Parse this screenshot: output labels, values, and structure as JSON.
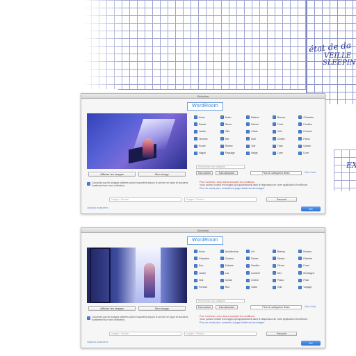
{
  "background": {
    "handwriting": [
      "état de da",
      "VEILLE",
      "SLEEPIN",
      "EX"
    ]
  },
  "dialogs": [
    {
      "title": "Sélection",
      "brand": "WordRoom",
      "photo_buttons": [
        "Afficher les images",
        "Mon image"
      ],
      "categories": [
        "Avion",
        "Avion",
        "Bateau",
        "Bureau",
        "Chambre",
        "Danse",
        "Décor",
        "Désert",
        "Foret",
        "Fenêtre",
        "Jardin",
        "Ville",
        "Chats",
        "Vélo",
        "Femme",
        "Homme",
        "Mer",
        "Nuit",
        "Ombre",
        "Piano",
        "Route",
        "Rivière",
        "Soir",
        "Train",
        "Urbain",
        "Vague",
        "Paysage",
        "Neige",
        "Lune",
        "Livre"
      ],
      "search_placeholder": "Rechercher une catégorie",
      "buttons": {
        "select_all": "Tout cocher",
        "deselect_all": "Tout décocher",
        "wide": "Plus de catégories libres",
        "help": "Aide / Aide"
      },
      "agree_text": "J'accepte que les images utilisées soient importées depuis le service en ligne et stockées localement sur mon ordinateur.",
      "red_note": "Pour continuer, vous devez accepter les conditions.",
      "grey_note": "Vous pouvez choisir les images qui apparaissent dans le diaporama de votre application WordRoom.",
      "blue_note": "Pour en savoir plus, consultez la page d'aide sur les images.",
      "input_1_placeholder": "Images / Dossier",
      "input_2_placeholder": "Images / Fichiers",
      "input_button": "Parcourir",
      "footer_link": "Options avancées",
      "ok": "OK"
    },
    {
      "title": "Sélection",
      "brand": "WordRoom",
      "photo_buttons": [
        "Afficher les images",
        "Mon image"
      ],
      "categories": [
        "Avion",
        "Architecture",
        "Art",
        "Bateau",
        "Bureau",
        "Chambre",
        "Couleur",
        "Danse",
        "Désert",
        "Détente",
        "Eau",
        "Enfants",
        "Fenêtre",
        "Fleurs",
        "Foret",
        "Jardin",
        "Lac",
        "Lumière",
        "Mer",
        "Montagne",
        "Nuit",
        "Océan",
        "Ombre",
        "Piano",
        "Pluie",
        "Portrait",
        "Rue",
        "Soleil",
        "Ville",
        "Voyage"
      ],
      "search_placeholder": "Rechercher une catégorie",
      "buttons": {
        "select_all": "Tout cocher",
        "deselect_all": "Tout décocher",
        "wide": "Plus de catégories libres",
        "help": "Aide / Aide"
      },
      "agree_text": "J'accepte que les images utilisées soient importées depuis le service en ligne et stockées localement sur mon ordinateur.",
      "red_note": "Pour continuer, vous devez accepter les conditions.",
      "grey_note": "Vous pouvez choisir les images qui apparaissent dans le diaporama de votre application WordRoom.",
      "blue_note": "Pour en savoir plus, consultez la page d'aide sur les images.",
      "input_1_placeholder": "Images / Dossier",
      "input_2_placeholder": "Images / Fichiers",
      "input_button": "Parcourir",
      "footer_link": "Options avancées",
      "ok": "OK"
    }
  ],
  "colors": {
    "accent": "#2f7bd0",
    "checkbox": "#4a82d1",
    "sketch": "#8d95c9",
    "warning": "#d8363a"
  }
}
